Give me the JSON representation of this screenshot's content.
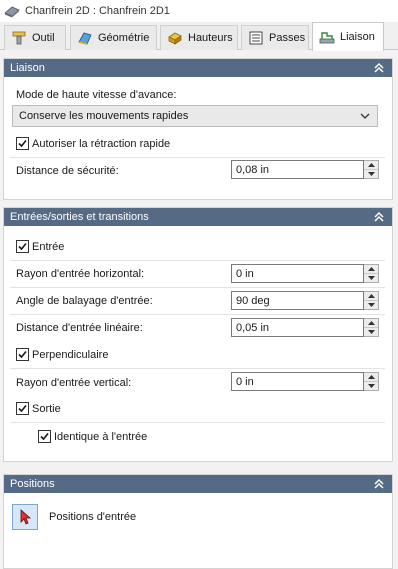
{
  "window": {
    "title": "Chanfrein 2D : Chanfrein 2D1"
  },
  "tabs": [
    {
      "label": "Outil",
      "icon": "tool-icon"
    },
    {
      "label": "Géométrie",
      "icon": "geometry-icon"
    },
    {
      "label": "Hauteurs",
      "icon": "heights-icon"
    },
    {
      "label": "Passes",
      "icon": "passes-icon"
    },
    {
      "label": "Liaison",
      "icon": "linking-icon",
      "active": true
    }
  ],
  "liaison": {
    "title": "Liaison",
    "mode_label": "Mode de haute vitesse d'avance:",
    "mode_value": "Conserve les mouvements rapides",
    "retract_label": "Autoriser la rétraction rapide",
    "retract_checked": true,
    "safe_distance_label": "Distance de sécurité:",
    "safe_distance_value": "0,08 in"
  },
  "leads": {
    "title": "Entrées/sorties et transitions",
    "entry_label": "Entrée",
    "entry_checked": true,
    "h_radius_label": "Rayon d'entrée horizontal:",
    "h_radius_value": "0 in",
    "sweep_label": "Angle de balayage d'entrée:",
    "sweep_value": "90 deg",
    "linear_label": "Distance d'entrée linéaire:",
    "linear_value": "0,05 in",
    "perp_label": "Perpendiculaire",
    "perp_checked": true,
    "v_radius_label": "Rayon d'entrée vertical:",
    "v_radius_value": "0 in",
    "exit_label": "Sortie",
    "exit_checked": true,
    "same_label": "Identique à l'entrée",
    "same_checked": true
  },
  "positions": {
    "title": "Positions",
    "entry_positions_label": "Positions d'entrée"
  },
  "colors": {
    "section_header": "#556a85",
    "checkmark": "#1a1a1a",
    "selection_button": "#d6e7f7"
  }
}
